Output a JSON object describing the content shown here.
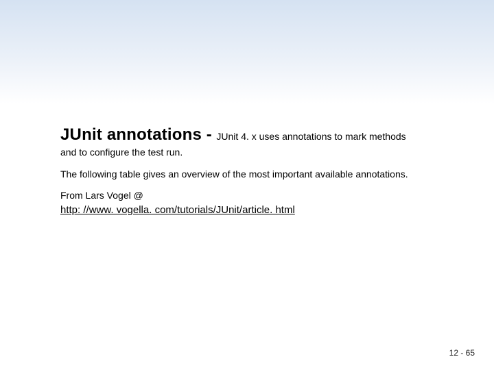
{
  "slide": {
    "title": "JUnit annotations",
    "dash": " - ",
    "subtitle_inline": "JUnit 4. x uses annotations to mark methods",
    "subtitle_cont": "and to configure the test run.",
    "paragraph": "The following table gives an overview of the most important available annotations.",
    "from_line": "From Lars Vogel @",
    "link_text": "http: //www. vogella. com/tutorials/JUnit/article. html",
    "page_number": "12 - 65"
  }
}
